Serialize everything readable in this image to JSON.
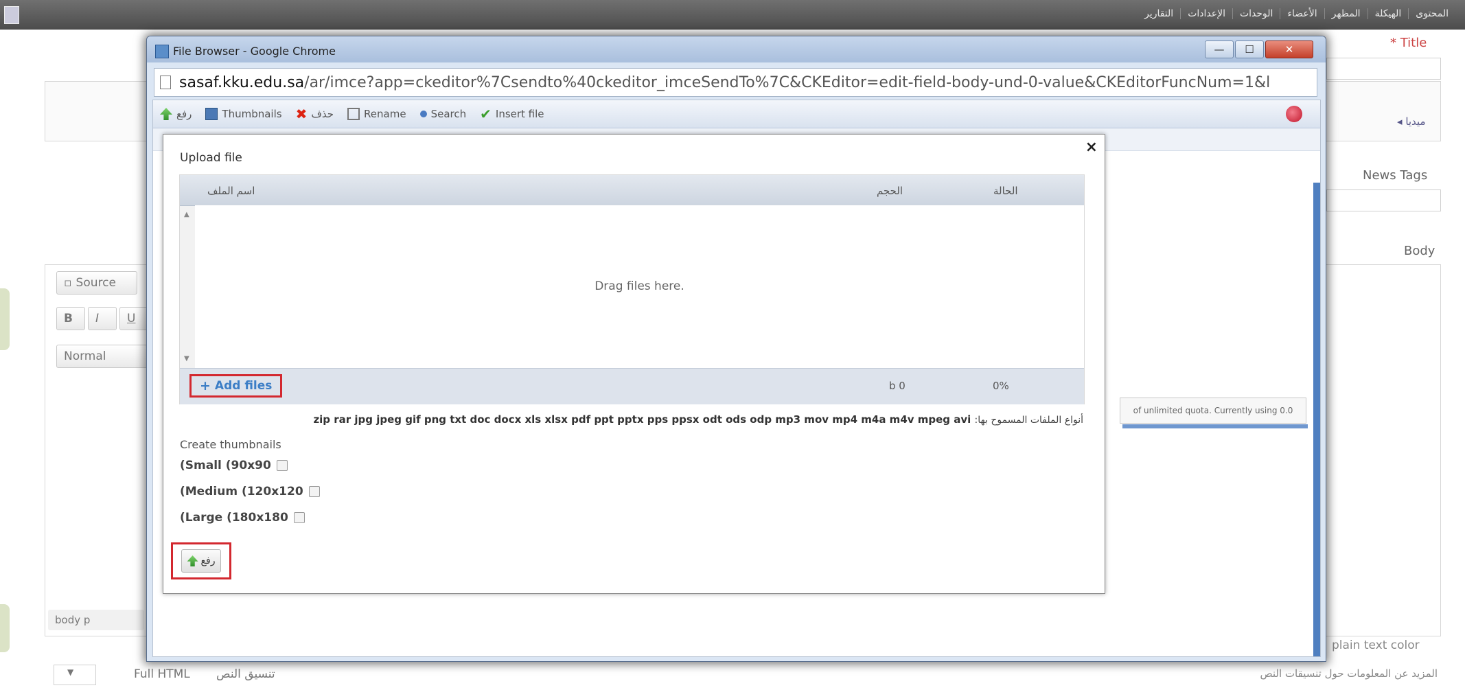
{
  "background": {
    "top_menu": [
      "المحتوى",
      "الهيكلة",
      "المظهر",
      "الأعضاء",
      "الوحدات",
      "الإعدادات",
      "التقارير"
    ],
    "title_label": "* Title",
    "media_label": "◂ ميديا",
    "news_tags_label": "News Tags",
    "body_label": "Body",
    "source_button": "Source",
    "bold_button": "B",
    "italic_button": "I",
    "underline_button": "U",
    "format_select": "Normal",
    "path_bar": "body p",
    "plain_text_color": "plain text color",
    "text_format_value": "Full HTML",
    "text_format_label": "تنسيق النص",
    "more_info_link": "المزيد عن المعلومات حول تنسيقات النص"
  },
  "window": {
    "title": "File Browser - Google Chrome",
    "url_host": "sasaf.kku.edu.sa",
    "url_rest": "/ar/imce?app=ckeditor%7Csendto%40ckeditor_imceSendTo%7C&CKEditor=edit-field-body-und-0-value&CKEditorFuncNum=1&l",
    "controls": {
      "minimize": "—",
      "maximize": "☐",
      "close": "✕"
    }
  },
  "toolbar": {
    "upload": "رفع",
    "thumbnails": "Thumbnails",
    "delete": "حذف",
    "rename": "Rename",
    "search": "Search",
    "insert": "Insert file"
  },
  "right_panel_text": "of unlimited quota. Currently using 0.0",
  "dialog": {
    "title": "Upload file",
    "close": "×",
    "columns": {
      "name": "اسم الملف",
      "size": "الحجم",
      "status": "الحالة"
    },
    "drop_text": "Drag files here.",
    "add_files": "Add files",
    "total_size": "b 0",
    "total_percent": "0%",
    "allowed_label": "أنواع الملفات المسموح بها:",
    "allowed_types": "zip rar jpg jpeg gif png txt doc docx xls xlsx pdf ppt pptx pps ppsx odt ods odp mp3 mov mp4 m4a m4v mpeg avi",
    "thumbnails_title": "Create thumbnails",
    "thumb_small": "(Small (90x90",
    "thumb_medium": "(Medium (120x120",
    "thumb_large": "(Large (180x180",
    "upload_button": "رفع"
  }
}
